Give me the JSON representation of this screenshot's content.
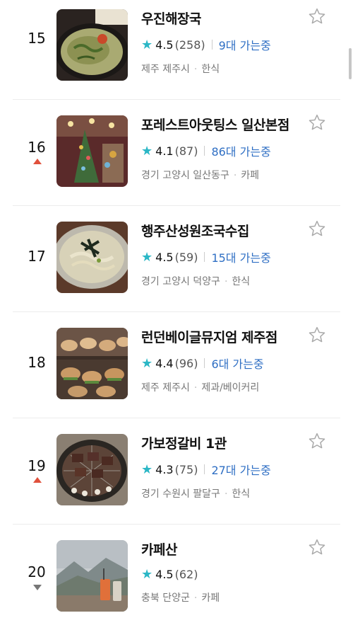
{
  "items": [
    {
      "rank": "15",
      "trend": "none",
      "name": "우진해장국",
      "rating": "4.5",
      "count": "(258)",
      "visits": "9대 가는중",
      "region": "제주 제주시",
      "category": "한식",
      "image": "haejangguk-photo"
    },
    {
      "rank": "16",
      "trend": "up",
      "name": "포레스트아웃팅스 일산본점",
      "rating": "4.1",
      "count": "(87)",
      "visits": "86대 가는중",
      "region": "경기 고양시 일산동구",
      "category": "카페",
      "image": "cafe-interior-photo"
    },
    {
      "rank": "17",
      "trend": "none",
      "name": "행주산성원조국수집",
      "rating": "4.5",
      "count": "(59)",
      "visits": "15대 가는중",
      "region": "경기 고양시 덕양구",
      "category": "한식",
      "image": "noodle-soup-photo"
    },
    {
      "rank": "18",
      "trend": "none",
      "name": "런던베이글뮤지엄 제주점",
      "rating": "4.4",
      "count": "(96)",
      "visits": "6대 가는중",
      "region": "제주 제주시",
      "category": "제과/베이커리",
      "image": "bagels-photo"
    },
    {
      "rank": "19",
      "trend": "up",
      "name": "가보정갈비 1관",
      "rating": "4.3",
      "count": "(75)",
      "visits": "27대 가는중",
      "region": "경기 수원시 팔달구",
      "category": "한식",
      "image": "galbi-grill-photo"
    },
    {
      "rank": "20",
      "trend": "down",
      "name": "카페산",
      "rating": "4.5",
      "count": "(62)",
      "visits": "",
      "region": "충북 단양군",
      "category": "카페",
      "image": "mountain-cafe-photo"
    }
  ],
  "colors": {
    "accent_teal": "#2bb7c6",
    "visits_blue": "#2f6fc4",
    "trend_up": "#e0513c",
    "trend_down": "#777777"
  }
}
